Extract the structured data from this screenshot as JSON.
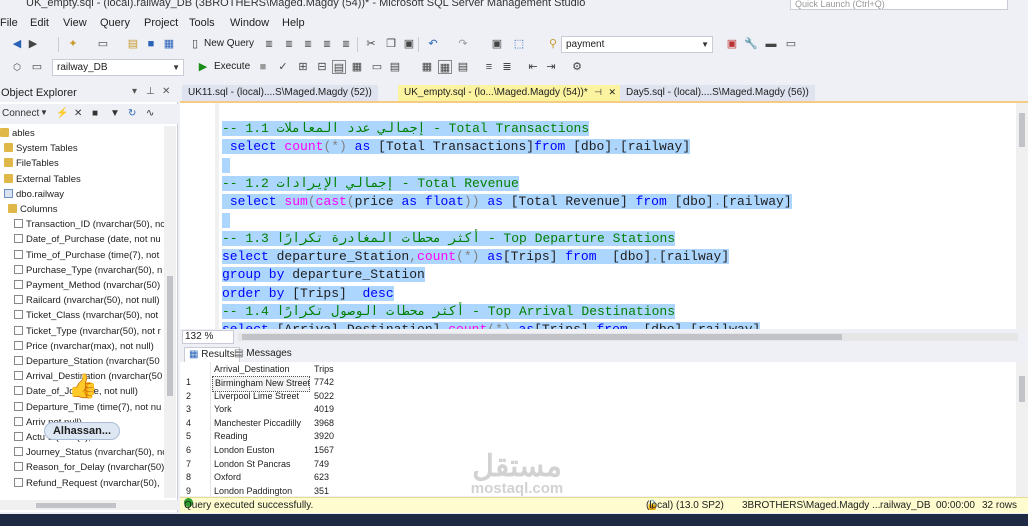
{
  "window": {
    "title": "UK_empty.sql - (local).railway_DB (3BROTHERS\\Maged.Magdy (54))* - Microsoft SQL Server Management Studio",
    "quick_launch_placeholder": "Quick Launch (Ctrl+Q)"
  },
  "menu": [
    "File",
    "Edit",
    "View",
    "Query",
    "Project",
    "Tools",
    "Window",
    "Help"
  ],
  "toolbar": {
    "new_query": "New Query",
    "search_value": "payment",
    "database": "railway_DB",
    "execute": "Execute"
  },
  "object_explorer": {
    "title": "Object Explorer",
    "connect": "Connect",
    "tree": [
      {
        "label": "ables",
        "icon": "folder"
      },
      {
        "label": "System Tables",
        "icon": "folder"
      },
      {
        "label": "FileTables",
        "icon": "folder"
      },
      {
        "label": "External Tables",
        "icon": "folder"
      },
      {
        "label": "dbo.railway",
        "icon": "table"
      },
      {
        "label": "Columns",
        "icon": "folder"
      },
      {
        "label": "Transaction_ID (nvarchar(50), nc",
        "icon": "column"
      },
      {
        "label": "Date_of_Purchase (date, not nu",
        "icon": "column"
      },
      {
        "label": "Time_of_Purchase (time(7), not",
        "icon": "column"
      },
      {
        "label": "Purchase_Type (nvarchar(50), n",
        "icon": "column"
      },
      {
        "label": "Payment_Method (nvarchar(50)",
        "icon": "column"
      },
      {
        "label": "Railcard (nvarchar(50), not null)",
        "icon": "column"
      },
      {
        "label": "Ticket_Class (nvarchar(50), not",
        "icon": "column"
      },
      {
        "label": "Ticket_Type (nvarchar(50), not r",
        "icon": "column"
      },
      {
        "label": "Price (nvarchar(max), not null)",
        "icon": "column"
      },
      {
        "label": "Departure_Station (nvarchar(50",
        "icon": "column"
      },
      {
        "label": "Arrival_Destination (nvarchar(50",
        "icon": "column"
      },
      {
        "label": "Date_of_Jo        (date, not null)",
        "icon": "column"
      },
      {
        "label": "Departure_Time (time(7), not nu",
        "icon": "column"
      },
      {
        "label": "Arriv                      not null)",
        "icon": "column"
      },
      {
        "label": "Actu              e (time(7), nu",
        "icon": "column"
      },
      {
        "label": "Journey_Status (nvarchar(50), nc",
        "icon": "column"
      },
      {
        "label": "Reason_for_Delay (nvarchar(50)",
        "icon": "column"
      },
      {
        "label": "Refund_Request (nvarchar(50),",
        "icon": "column"
      }
    ],
    "overlay_name": "Alhassan..."
  },
  "tabs": [
    {
      "label": "UK11.sql - (local)....S\\Maged.Magdy (52))",
      "active": false
    },
    {
      "label": "UK_empty.sql - (lo...\\Maged.Magdy (54))*",
      "active": true
    },
    {
      "label": "Day5.sql - (local)....S\\Maged.Magdy (56))",
      "active": false
    }
  ],
  "editor": {
    "zoom": "132 %",
    "lines": [
      {
        "indent": "",
        "parts": [
          {
            "t": "-- 1.1 إجمالي عدد المعاملات - Total Transactions",
            "c": "cm"
          }
        ]
      },
      {
        "indent": " ",
        "parts": [
          {
            "t": "select ",
            "c": "kw"
          },
          {
            "t": "count",
            "c": "fn"
          },
          {
            "t": "(*)",
            "c": "gr"
          },
          {
            "t": " as ",
            "c": "kw"
          },
          {
            "t": "[Total Transactions]",
            "c": ""
          },
          {
            "t": "from ",
            "c": "kw"
          },
          {
            "t": "[dbo]",
            "c": ""
          },
          {
            "t": ".",
            "c": "gr"
          },
          {
            "t": "[railway]",
            "c": ""
          }
        ]
      },
      {
        "indent": "",
        "parts": []
      },
      {
        "indent": "",
        "parts": [
          {
            "t": "-- 1.2 إجمالي الإيرادات - Total Revenue",
            "c": "cm"
          }
        ]
      },
      {
        "indent": " ",
        "parts": [
          {
            "t": "select ",
            "c": "kw"
          },
          {
            "t": "sum",
            "c": "fn"
          },
          {
            "t": "(",
            "c": "gr"
          },
          {
            "t": "cast",
            "c": "fn"
          },
          {
            "t": "(",
            "c": "gr"
          },
          {
            "t": "price ",
            "c": ""
          },
          {
            "t": "as ",
            "c": "kw"
          },
          {
            "t": "float",
            "c": "kw"
          },
          {
            "t": "))",
            "c": "gr"
          },
          {
            "t": " as ",
            "c": "kw"
          },
          {
            "t": "[Total Revenue] ",
            "c": ""
          },
          {
            "t": "from ",
            "c": "kw"
          },
          {
            "t": "[dbo]",
            "c": ""
          },
          {
            "t": ".",
            "c": "gr"
          },
          {
            "t": "[railway]",
            "c": ""
          }
        ]
      },
      {
        "indent": "",
        "parts": []
      },
      {
        "indent": "",
        "parts": [
          {
            "t": "-- 1.3 أكثر محطات المغادرة تكرارًا - Top Departure Stations",
            "c": "cm"
          }
        ]
      },
      {
        "indent": "",
        "parts": [
          {
            "t": "select ",
            "c": "kw"
          },
          {
            "t": "departure_Station",
            "c": ""
          },
          {
            "t": ",",
            "c": "gr"
          },
          {
            "t": "count",
            "c": "fn"
          },
          {
            "t": "(*)",
            "c": "gr"
          },
          {
            "t": " as",
            "c": "kw"
          },
          {
            "t": "[Trips] ",
            "c": ""
          },
          {
            "t": "from  ",
            "c": "kw"
          },
          {
            "t": "[dbo]",
            "c": ""
          },
          {
            "t": ".",
            "c": "gr"
          },
          {
            "t": "[railway]",
            "c": ""
          }
        ]
      },
      {
        "indent": "",
        "parts": [
          {
            "t": "group by ",
            "c": "kw"
          },
          {
            "t": "departure_Station",
            "c": ""
          }
        ]
      },
      {
        "indent": "",
        "parts": [
          {
            "t": "order by ",
            "c": "kw"
          },
          {
            "t": "[Trips]  ",
            "c": ""
          },
          {
            "t": "desc",
            "c": "kw"
          }
        ]
      },
      {
        "indent": "",
        "parts": [
          {
            "t": "-- 1.4 أكثر محطات الوصول تكرارًا - Top Arrival Destinations",
            "c": "cm"
          }
        ]
      },
      {
        "indent": "",
        "parts": [
          {
            "t": "select ",
            "c": "kw"
          },
          {
            "t": "[Arrival_Destination]",
            "c": ""
          },
          {
            "t": ",",
            "c": "gr"
          },
          {
            "t": "count",
            "c": "fn"
          },
          {
            "t": "(*)",
            "c": "gr"
          },
          {
            "t": " as",
            "c": "kw"
          },
          {
            "t": "[Trips] ",
            "c": ""
          },
          {
            "t": "from  ",
            "c": "kw"
          },
          {
            "t": "[dbo]",
            "c": ""
          },
          {
            "t": ".",
            "c": "gr"
          },
          {
            "t": "[railway]",
            "c": ""
          }
        ]
      }
    ]
  },
  "results": {
    "tab_results": "Results",
    "tab_messages": "Messages",
    "columns": [
      "Arrival_Destination",
      "Trips"
    ],
    "rows": [
      [
        "1",
        "Birmingham New Street",
        "7742"
      ],
      [
        "2",
        "Liverpool Lime Street",
        "5022"
      ],
      [
        "3",
        "York",
        "4019"
      ],
      [
        "4",
        "Manchester Piccadilly",
        "3968"
      ],
      [
        "5",
        "Reading",
        "3920"
      ],
      [
        "6",
        "London Euston",
        "1567"
      ],
      [
        "7",
        "London St Pancras",
        "749"
      ],
      [
        "8",
        "Oxford",
        "623"
      ],
      [
        "9",
        "London Paddington",
        "351"
      ]
    ]
  },
  "watermark": {
    "ar": "مستقل",
    "en": "mostaql.com"
  },
  "status": {
    "message": "Query executed successfully.",
    "server": "(local) (13.0 SP2)",
    "user": "3BROTHERS\\Maged.Magdy ...",
    "db": "railway_DB",
    "time": "00:00:00",
    "rows": "32 rows"
  }
}
